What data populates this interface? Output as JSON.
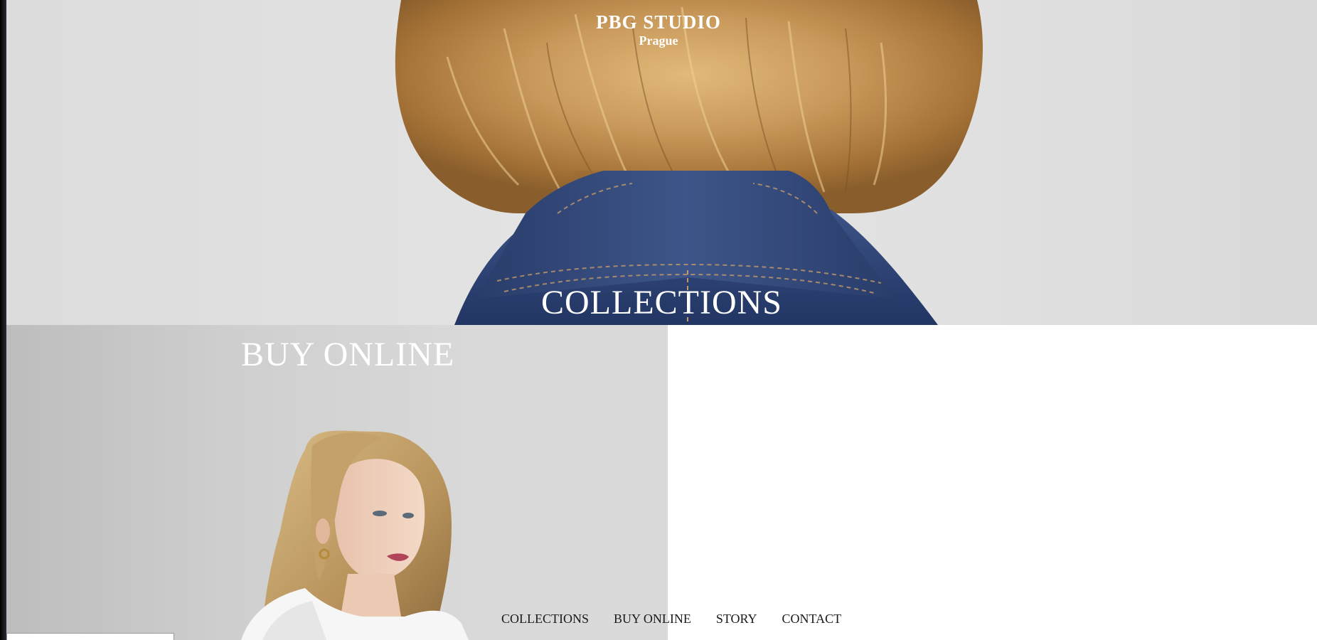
{
  "brand": {
    "name": "PBG STUDIO",
    "city": "Prague"
  },
  "hero": {
    "title": "COLLECTIONS"
  },
  "buy_panel": {
    "title": "BUY ONLINE"
  },
  "nav": {
    "items": [
      {
        "label": "COLLECTIONS"
      },
      {
        "label": "BUY ONLINE"
      },
      {
        "label": "STORY"
      },
      {
        "label": "CONTACT"
      }
    ]
  },
  "colors": {
    "background": "#ffffff",
    "hero_background": "#e0e0e0",
    "hair": "#c89a5a",
    "denim": "#2f4575",
    "text_light": "#ffffff",
    "nav_text": "#1a1a1a"
  }
}
